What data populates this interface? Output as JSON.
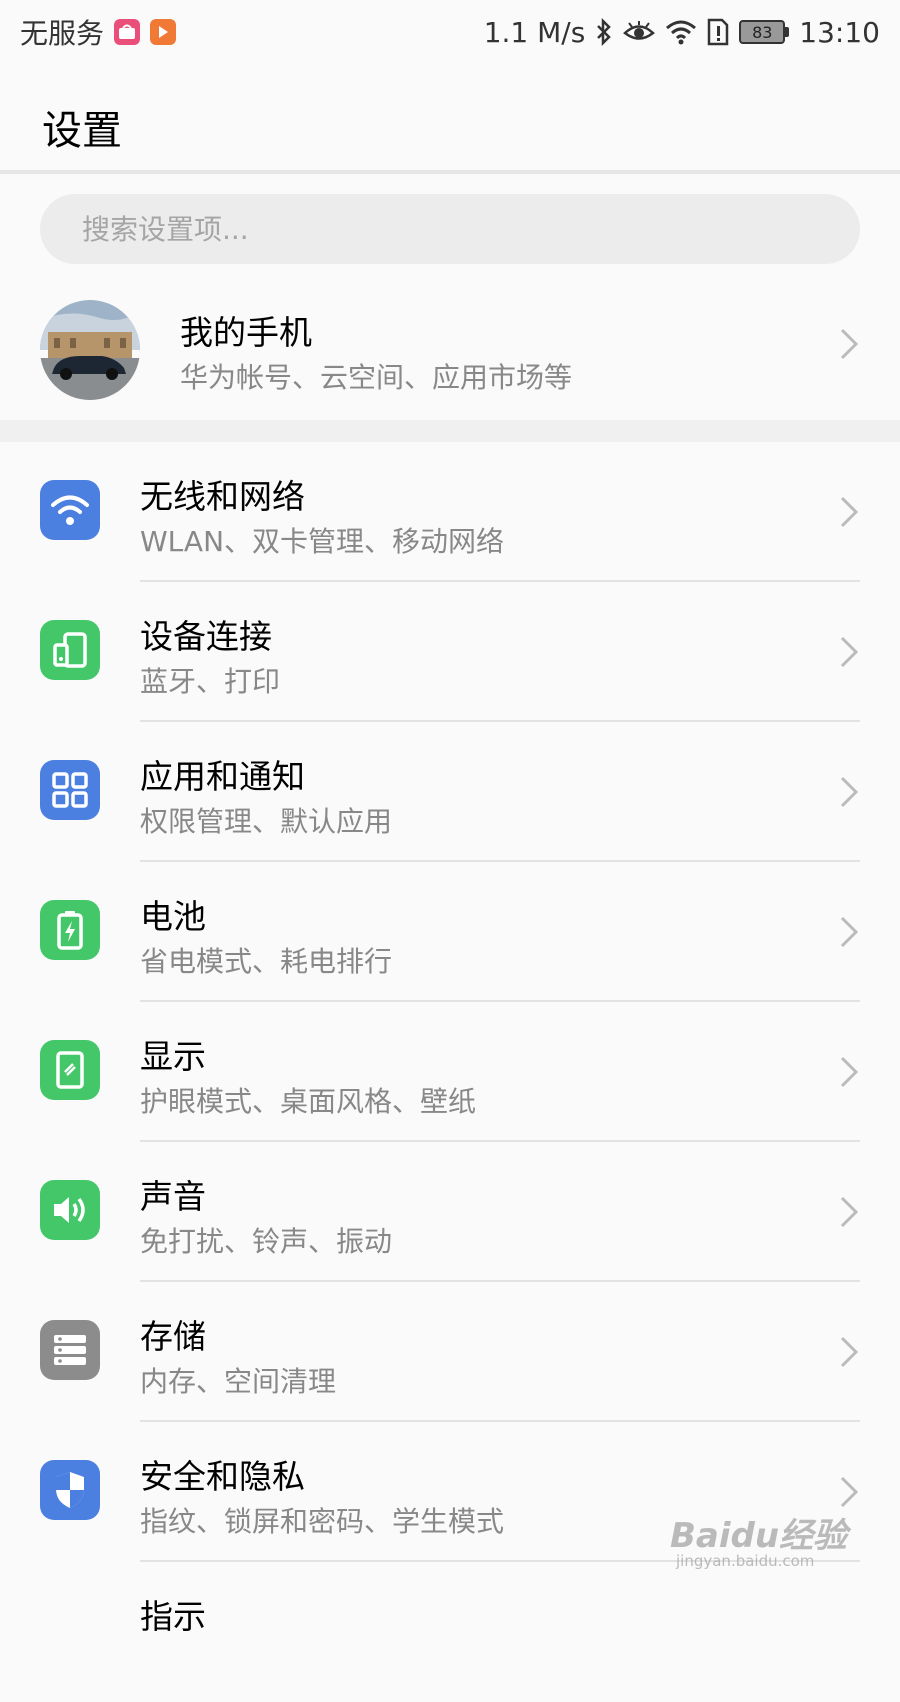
{
  "status_bar": {
    "carrier": "无服务",
    "speed": "1.1 M/s",
    "battery": "83",
    "time": "13:10",
    "icons": [
      "shop-app-icon",
      "video-app-icon",
      "bluetooth-icon",
      "eye-care-icon",
      "wifi-icon",
      "sim-alert-icon",
      "battery-icon"
    ]
  },
  "header": {
    "title": "设置"
  },
  "search": {
    "placeholder": "搜索设置项..."
  },
  "profile": {
    "title": "我的手机",
    "subtitle": "华为帐号、云空间、应用市场等"
  },
  "settings": [
    {
      "title": "无线和网络",
      "subtitle": "WLAN、双卡管理、移动网络",
      "icon": "wifi-icon",
      "color": "#4b7fe0"
    },
    {
      "title": "设备连接",
      "subtitle": "蓝牙、打印",
      "icon": "device-connection-icon",
      "color": "#43c768"
    },
    {
      "title": "应用和通知",
      "subtitle": "权限管理、默认应用",
      "icon": "apps-grid-icon",
      "color": "#4b7fe0"
    },
    {
      "title": "电池",
      "subtitle": "省电模式、耗电排行",
      "icon": "battery-charging-icon",
      "color": "#43c768"
    },
    {
      "title": "显示",
      "subtitle": "护眼模式、桌面风格、壁纸",
      "icon": "display-icon",
      "color": "#43c768"
    },
    {
      "title": "声音",
      "subtitle": "免打扰、铃声、振动",
      "icon": "speaker-icon",
      "color": "#43c768"
    },
    {
      "title": "存储",
      "subtitle": "内存、空间清理",
      "icon": "storage-icon",
      "color": "#8c8c8c"
    },
    {
      "title": "安全和隐私",
      "subtitle": "指纹、锁屏和密码、学生模式",
      "icon": "shield-icon",
      "color": "#4b7fe0"
    },
    {
      "title": "指示",
      "subtitle": "",
      "icon": "",
      "color": "#43c768"
    }
  ],
  "watermark": {
    "brand": "Baidu经验",
    "url": "jingyan.baidu.com"
  }
}
